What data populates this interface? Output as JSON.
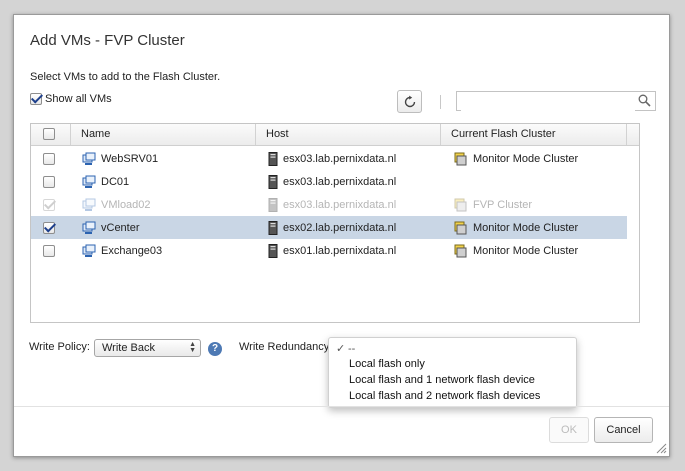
{
  "dialog": {
    "title": "Add VMs - FVP Cluster",
    "subtitle": "Select VMs to add to the Flash Cluster.",
    "show_all_label": "Show all VMs",
    "show_all_checked": true,
    "search_placeholder": ""
  },
  "table": {
    "columns": [
      "Name",
      "Host",
      "Current Flash Cluster"
    ],
    "rows": [
      {
        "checked": false,
        "disabled": false,
        "selected": false,
        "name": "WebSRV01",
        "host": "esx03.lab.pernixdata.nl",
        "cluster": "Monitor Mode Cluster"
      },
      {
        "checked": false,
        "disabled": false,
        "selected": false,
        "name": "DC01",
        "host": "esx03.lab.pernixdata.nl",
        "cluster": ""
      },
      {
        "checked": true,
        "disabled": true,
        "selected": false,
        "name": "VMload02",
        "host": "esx03.lab.pernixdata.nl",
        "cluster": "FVP Cluster"
      },
      {
        "checked": true,
        "disabled": false,
        "selected": true,
        "name": "vCenter",
        "host": "esx02.lab.pernixdata.nl",
        "cluster": "Monitor Mode Cluster"
      },
      {
        "checked": false,
        "disabled": false,
        "selected": false,
        "name": "Exchange03",
        "host": "esx01.lab.pernixdata.nl",
        "cluster": "Monitor Mode Cluster"
      }
    ]
  },
  "options": {
    "write_policy_label": "Write Policy:",
    "write_policy_value": "Write Back",
    "help_glyph": "?",
    "write_redundancy_label": "Write Redundancy",
    "redundancy_options": [
      "--",
      "Local flash only",
      "Local flash and 1 network flash device",
      "Local flash and 2 network flash devices"
    ],
    "redundancy_selected_index": 0,
    "check_glyph": "✓"
  },
  "buttons": {
    "ok": "OK",
    "cancel": "Cancel"
  },
  "colors": {
    "selected_row": "#c9d6e5",
    "help_icon": "#4d79b4"
  }
}
